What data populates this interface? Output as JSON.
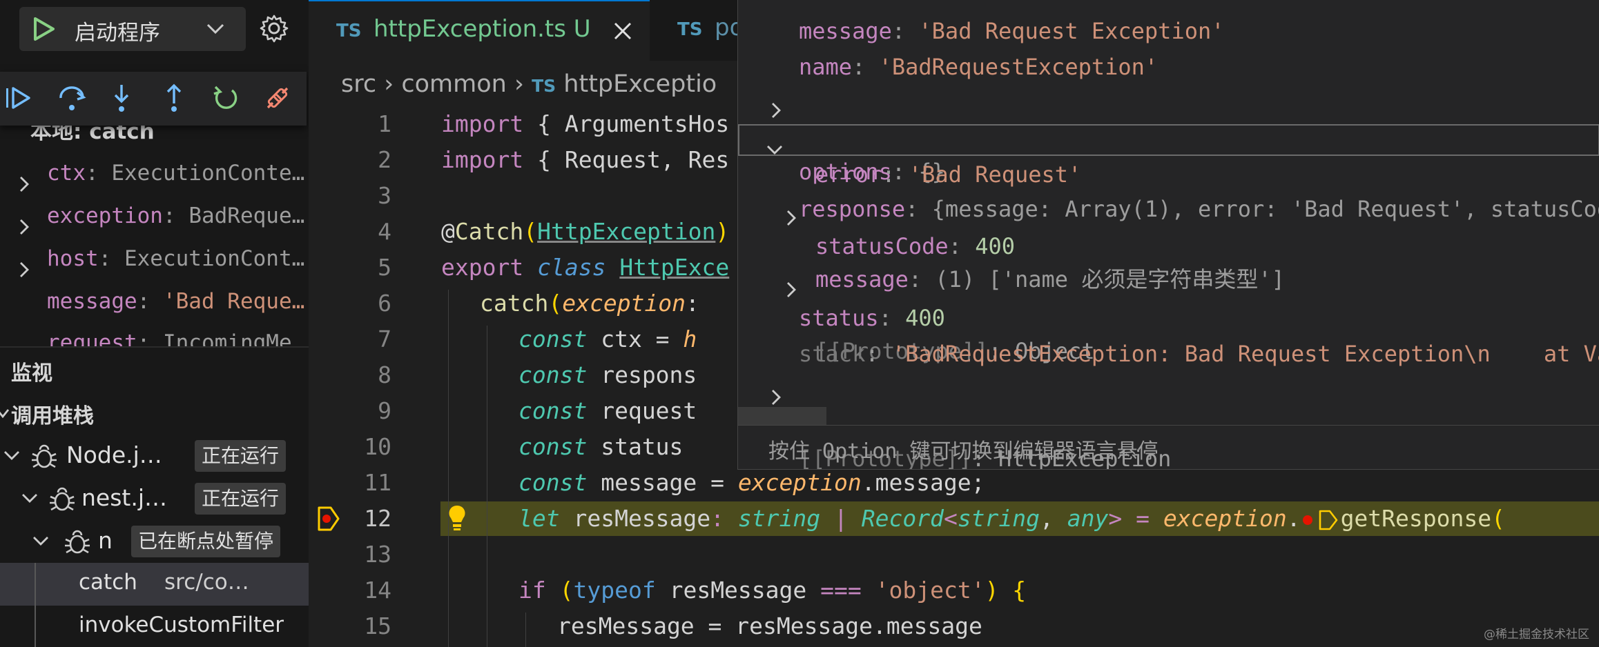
{
  "launch": {
    "label": "启动程序",
    "play_icon": "play-icon",
    "chevron_icon": "chevron-down-icon",
    "settings_icon": "gear-icon"
  },
  "debug_toolbar": {
    "icons": [
      "continue-icon",
      "step-over-icon",
      "step-into-icon",
      "step-out-icon",
      "restart-icon",
      "disconnect-icon"
    ]
  },
  "variables": {
    "scope_label": "本地: catch",
    "items": [
      {
        "name": "ctx",
        "value": "ExecutionConte…"
      },
      {
        "name": "exception",
        "value": "BadReque…"
      },
      {
        "name": "host",
        "value": "ExecutionCont…"
      },
      {
        "name": "message",
        "value": "'Bad Reque…"
      },
      {
        "name": "request",
        "value": "IncomingMe…"
      }
    ]
  },
  "watch": {
    "label": "监视"
  },
  "callstack": {
    "label": "调用堆栈",
    "sessions": [
      {
        "name": "Node.j…",
        "badge": "正在运行"
      },
      {
        "name": "nest.j…",
        "badge": "正在运行"
      },
      {
        "name": "n",
        "badge": "已在断点处暂停"
      }
    ],
    "frames": [
      {
        "fn": "catch",
        "path": "src/co…"
      },
      {
        "fn": "invokeCustomFilter",
        "path": ""
      }
    ]
  },
  "tabs": [
    {
      "icon": "TS",
      "name": "httpException.ts",
      "status": "U",
      "active": true
    },
    {
      "icon": "TS",
      "name": "po",
      "status": "",
      "active": false
    }
  ],
  "breadcrumb": {
    "items": [
      "src",
      "common",
      "httpExceptio"
    ],
    "file_icon": "TS"
  },
  "code": {
    "line_numbers": [
      "1",
      "2",
      "3",
      "4",
      "5",
      "6",
      "7",
      "8",
      "9",
      "10",
      "11",
      "12",
      "13",
      "14",
      "15"
    ],
    "current_line": "12",
    "l1": {
      "a": "import",
      "b": " { ArgumentsHos"
    },
    "l2": {
      "a": "import",
      "b": " { Request, Res"
    },
    "l4": {
      "at": "@",
      "fn": "Catch",
      "p1": "(",
      "cls": "HttpException",
      "p2": ")"
    },
    "l5": {
      "a": "export",
      "b": " ",
      "c": "class",
      "d": " ",
      "cls": "HttpExce"
    },
    "l6": {
      "fn": "catch",
      "p": "(",
      "param": "exception",
      "colon": ":"
    },
    "l7": {
      "kw": "const",
      "rest": " ctx = ",
      "h": "h"
    },
    "l8": {
      "kw": "const",
      "rest": " respons"
    },
    "l9": {
      "kw": "const",
      "rest": " request"
    },
    "l10": {
      "kw": "const",
      "rest": " status"
    },
    "l11": {
      "kw": "const",
      "rest": " message = ",
      "ex": "exception",
      "tail": ".message;"
    },
    "l12": {
      "kw": "let",
      "var": " resMessage",
      "colon": ":",
      "t1": " string",
      "bar": " | ",
      "t2": "Record",
      "lt": "<",
      "t3": "string",
      "comma": ", ",
      "t4": "any",
      "gt": ">",
      "eq": " = ",
      "ex": "exception",
      "dot": ".",
      "fn": "getResponse",
      "paren": "("
    },
    "l14": {
      "kw": "if",
      "p1": " (",
      "op": "typeof",
      "var": " resMessage ",
      "eq": "===",
      "str": " 'object'",
      "p2": ")",
      "br": " {"
    },
    "l15": {
      "lhs": "resMessage",
      "eq": " = ",
      "rhs": "resMessage.message"
    }
  },
  "hover": {
    "rows": [
      {
        "key": "message",
        "value": "'Bad Request Exception'"
      },
      {
        "key": "name",
        "value": "'BadRequestException'"
      },
      {
        "key": "options",
        "value": "{}"
      },
      {
        "key": "response",
        "value": "{message: Array(1), error: 'Bad Request', statusCod"
      },
      {
        "key": "error",
        "value": "'Bad Request'"
      },
      {
        "key": "message",
        "value_count": "(1)",
        "value": " ['name 必须是字符串类型']"
      },
      {
        "key": "statusCode",
        "value": "400"
      },
      {
        "key": "[[Prototype]]",
        "value": "Object"
      },
      {
        "key": "status",
        "value": "400"
      },
      {
        "key": "stack",
        "value": "'BadRequestException: Bad Request Exception\\n    at Va"
      },
      {
        "key": "[[Prototype]]",
        "value": "HttpException"
      }
    ],
    "footer": "按住 Option 键可切换到编辑器语言悬停"
  },
  "watermark": "@稀土掘金技术社区",
  "colors": {
    "accent_debug": "#89d185",
    "breakpoint": "#e51400",
    "lightbulb": "#ffcc00",
    "current_line_bg": "#4b4b1d"
  }
}
